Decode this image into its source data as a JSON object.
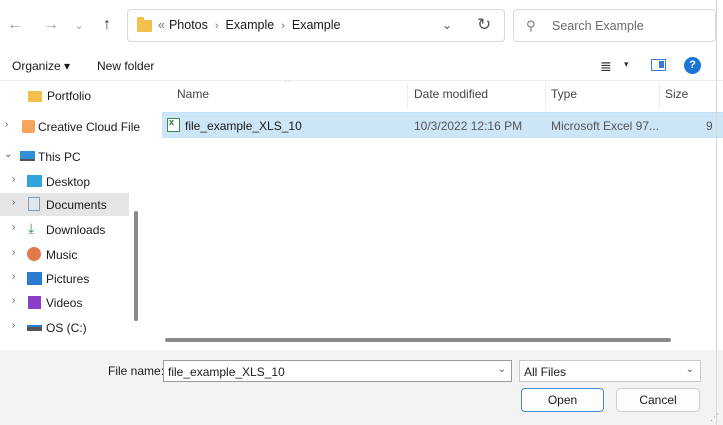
{
  "window": {
    "nav": {
      "back": "←",
      "forward": "→",
      "recent": "⌄",
      "up": "↑"
    },
    "address": {
      "overflow": "«",
      "crumbs": [
        "Photos",
        "Example",
        "Example"
      ],
      "separator": "›"
    },
    "search": {
      "placeholder": "Search Example"
    }
  },
  "toolbar": {
    "organize": "Organize ▾",
    "new_folder": "New folder",
    "help": "?"
  },
  "sidebar": {
    "items": [
      {
        "label": "Portfolio",
        "icon": "folder-icon",
        "expandable": false,
        "selected": false
      },
      {
        "label": "Creative Cloud Files",
        "icon": "creative-cloud-icon",
        "expandable": true,
        "selected": false
      },
      {
        "label": "This PC",
        "icon": "pc-icon",
        "expandable": true,
        "expanded": true,
        "selected": false
      },
      {
        "label": "Desktop",
        "icon": "desktop-icon",
        "expandable": true,
        "selected": false
      },
      {
        "label": "Documents",
        "icon": "documents-icon",
        "expandable": true,
        "selected": true
      },
      {
        "label": "Downloads",
        "icon": "downloads-icon",
        "expandable": true,
        "selected": false
      },
      {
        "label": "Music",
        "icon": "music-icon",
        "expandable": true,
        "selected": false
      },
      {
        "label": "Pictures",
        "icon": "pictures-icon",
        "expandable": true,
        "selected": false
      },
      {
        "label": "Videos",
        "icon": "videos-icon",
        "expandable": true,
        "selected": false
      },
      {
        "label": "OS (C:)",
        "icon": "drive-icon",
        "expandable": true,
        "selected": false
      }
    ]
  },
  "file_list": {
    "columns": [
      "Name",
      "Date modified",
      "Type",
      "Size"
    ],
    "rows": [
      {
        "name": "file_example_XLS_10",
        "date_modified": "10/3/2022 12:16 PM",
        "type": "Microsoft Excel 97...",
        "size": "9",
        "selected": true
      }
    ]
  },
  "footer": {
    "file_name_label": "File name:",
    "file_name_value": "file_example_XLS_10",
    "filter_value": "All Files",
    "open_label": "Open",
    "cancel_label": "Cancel"
  },
  "colors": {
    "selection": "#cde6f7",
    "accent": "#1c75d6",
    "folder": "#f3c14b"
  }
}
